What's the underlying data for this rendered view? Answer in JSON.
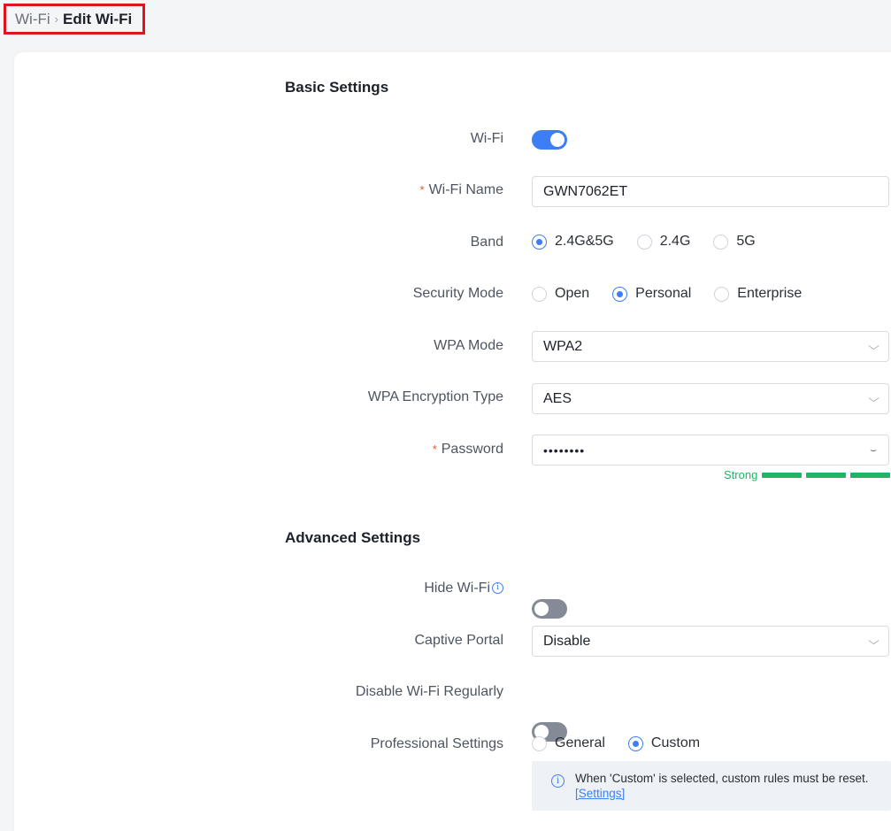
{
  "breadcrumb": {
    "parent": "Wi-Fi",
    "separator": "›",
    "current": "Edit Wi-Fi"
  },
  "basic": {
    "title": "Basic Settings",
    "wifi": {
      "label": "Wi-Fi",
      "enabled": true
    },
    "name": {
      "required": "*",
      "label": "Wi-Fi Name",
      "value": "GWN7062ET"
    },
    "band": {
      "label": "Band",
      "options": [
        "2.4G&5G",
        "2.4G",
        "5G"
      ],
      "selected": "2.4G&5G"
    },
    "security": {
      "label": "Security Mode",
      "options": [
        "Open",
        "Personal",
        "Enterprise"
      ],
      "selected": "Personal"
    },
    "wpa_mode": {
      "label": "WPA Mode",
      "value": "WPA2"
    },
    "encryption": {
      "label": "WPA Encryption Type",
      "value": "AES"
    },
    "password": {
      "required": "*",
      "label": "Password",
      "value": "••••••••",
      "strength": "Strong",
      "strength_level": 3
    }
  },
  "advanced": {
    "title": "Advanced Settings",
    "hide": {
      "label": "Hide Wi-Fi",
      "enabled": false
    },
    "portal": {
      "label": "Captive Portal",
      "value": "Disable"
    },
    "disable_regularly": {
      "label": "Disable Wi-Fi Regularly",
      "enabled": false
    },
    "professional": {
      "label": "Professional Settings",
      "options": [
        "General",
        "Custom"
      ],
      "selected": "Custom"
    },
    "notice": {
      "text": "When 'Custom' is selected, custom rules must be reset.",
      "link": "[Settings]"
    }
  },
  "colors": {
    "accent": "#3d7ef5",
    "strength": "#1fb565",
    "highlight_border": "#e0141e"
  }
}
